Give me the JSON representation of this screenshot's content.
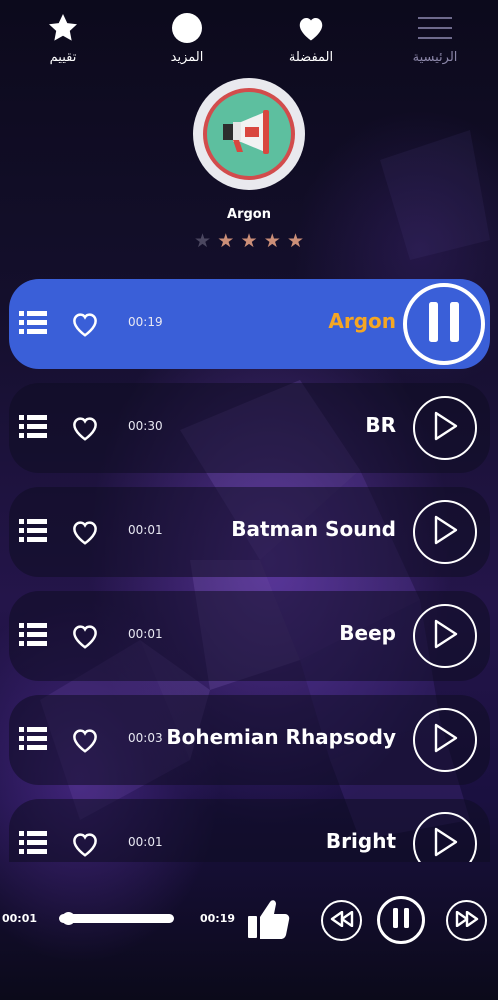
{
  "nav": {
    "rate": {
      "label": "تقييم",
      "icon": "star-icon"
    },
    "more": {
      "label": "المزيد",
      "icon": "circle-icon"
    },
    "favorites": {
      "label": "المفضلة",
      "icon": "heart-icon"
    },
    "home": {
      "label": "الرئيسية",
      "icon": "hamburger-icon"
    }
  },
  "now_playing": {
    "title": "Argon",
    "cover_icon": "megaphone-icon",
    "rating": 4,
    "rating_max": 5
  },
  "tracks": [
    {
      "name": "Argon",
      "duration": "00:19",
      "state": "playing"
    },
    {
      "name": "BR",
      "duration": "00:30",
      "state": "idle"
    },
    {
      "name": "Batman Sound",
      "duration": "00:01",
      "state": "idle"
    },
    {
      "name": "Beep",
      "duration": "00:01",
      "state": "idle"
    },
    {
      "name": "Bohemian Rhapsody",
      "duration": "00:03",
      "state": "idle"
    },
    {
      "name": "Bright",
      "duration": "00:01",
      "state": "idle"
    }
  ],
  "player": {
    "current_time": "00:01",
    "total_time": "00:19",
    "progress": 0.05
  },
  "colors": {
    "active_row": "#3a5fd8",
    "active_title": "#f5a623",
    "star_on": "#cc8f78",
    "star_off": "#4b4760"
  }
}
